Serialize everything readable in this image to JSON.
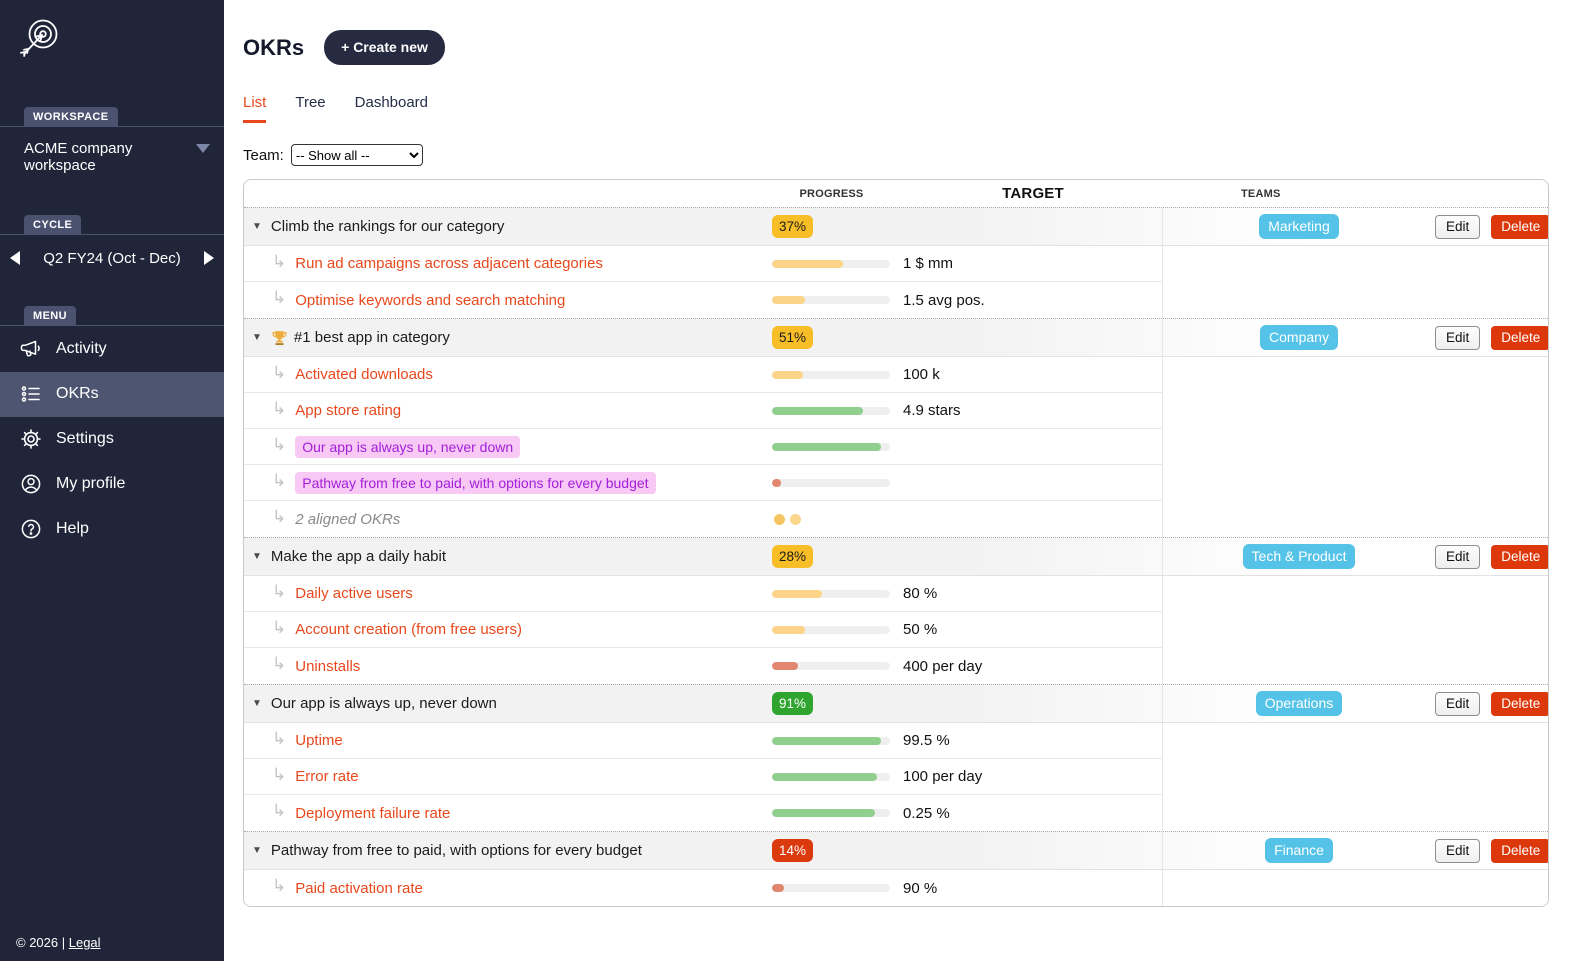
{
  "sidebar": {
    "workspace_label": "WORKSPACE",
    "workspace_name": "ACME company workspace",
    "cycle_label": "CYCLE",
    "cycle_name": "Q2 FY24 (Oct - Dec)",
    "menu_label": "MENU",
    "menu_items": [
      {
        "label": "Activity",
        "icon": "megaphone",
        "active": false
      },
      {
        "label": "OKRs",
        "icon": "okr-list",
        "active": true
      },
      {
        "label": "Settings",
        "icon": "gear",
        "active": false
      },
      {
        "label": "My profile",
        "icon": "profile",
        "active": false
      },
      {
        "label": "Help",
        "icon": "help",
        "active": false
      }
    ],
    "footer_copyright": "© 2026 |",
    "footer_link": "Legal"
  },
  "header": {
    "title": "OKRs",
    "create_button_label": "+ Create new"
  },
  "tabs": [
    {
      "label": "List",
      "active": true
    },
    {
      "label": "Tree",
      "active": false
    },
    {
      "label": "Dashboard",
      "active": false
    }
  ],
  "team_filter": {
    "label": "Team:",
    "selected": "-- Show all --"
  },
  "table": {
    "columns": {
      "progress": "PROGRESS",
      "target": "TARGET",
      "teams": "TEAMS"
    },
    "actions": {
      "edit": "Edit",
      "delete": "Delete"
    },
    "groups": [
      {
        "objective": {
          "title": "Climb the rankings for our category",
          "trophy": false,
          "progress": "37%",
          "progress_level": "amber",
          "team": "Marketing"
        },
        "key_results": [
          {
            "type": "kr",
            "title": "Run ad campaigns across adjacent categories",
            "bar_color": "amber",
            "bar_pct": 60,
            "target": "1 $ mm"
          },
          {
            "type": "kr",
            "title": "Optimise keywords and search matching",
            "bar_color": "amber",
            "bar_pct": 28,
            "target": "1.5 avg pos."
          }
        ]
      },
      {
        "objective": {
          "title": "#1 best app in category",
          "trophy": true,
          "progress": "51%",
          "progress_level": "amber",
          "team": "Company"
        },
        "key_results": [
          {
            "type": "kr",
            "title": "Activated downloads",
            "bar_color": "amber",
            "bar_pct": 26,
            "target": "100 k"
          },
          {
            "type": "kr",
            "title": "App store rating",
            "bar_color": "green",
            "bar_pct": 77,
            "target": "4.9 stars"
          },
          {
            "type": "aligned",
            "title": "Our app is always up, never down",
            "bar_color": "green",
            "bar_pct": 92,
            "target": ""
          },
          {
            "type": "aligned",
            "title": "Pathway from free to paid, with options for every budget",
            "bar_color": "red",
            "bar_pct": 8,
            "target": ""
          },
          {
            "type": "summary",
            "title": "2 aligned OKRs",
            "dots": [
              "#f5c562",
              "#fad88b"
            ],
            "target": ""
          }
        ]
      },
      {
        "objective": {
          "title": "Make the app a daily habit",
          "trophy": false,
          "progress": "28%",
          "progress_level": "amber",
          "team": "Tech & Product"
        },
        "key_results": [
          {
            "type": "kr",
            "title": "Daily active users",
            "bar_color": "amber",
            "bar_pct": 42,
            "target": "80 %"
          },
          {
            "type": "kr",
            "title": "Account creation (from free users)",
            "bar_color": "amber",
            "bar_pct": 28,
            "target": "50 %"
          },
          {
            "type": "kr",
            "title": "Uninstalls",
            "bar_color": "red",
            "bar_pct": 22,
            "target": "400 per day"
          }
        ]
      },
      {
        "objective": {
          "title": "Our app is always up, never down",
          "trophy": false,
          "progress": "91%",
          "progress_level": "green",
          "team": "Operations"
        },
        "key_results": [
          {
            "type": "kr",
            "title": "Uptime",
            "bar_color": "green",
            "bar_pct": 92,
            "target": "99.5 %"
          },
          {
            "type": "kr",
            "title": "Error rate",
            "bar_color": "green",
            "bar_pct": 89,
            "target": "100 per day"
          },
          {
            "type": "kr",
            "title": "Deployment failure rate",
            "bar_color": "green",
            "bar_pct": 87,
            "target": "0.25 %"
          }
        ]
      },
      {
        "objective": {
          "title": "Pathway from free to paid, with options for every budget",
          "trophy": false,
          "progress": "14%",
          "progress_level": "red",
          "team": "Finance"
        },
        "key_results": [
          {
            "type": "kr",
            "title": "Paid activation rate",
            "bar_color": "red",
            "bar_pct": 10,
            "target": "90 %"
          }
        ]
      }
    ]
  },
  "colors": {
    "accent": "#e8481c",
    "sidebar_bg": "#212539",
    "badge_amber": "#f7be27",
    "badge_green": "#2fa52f",
    "badge_red": "#db390e",
    "bar_amber": "#fbd489",
    "bar_green": "#90cf8e",
    "bar_red": "#e2876f",
    "team_badge": "#55c3e8",
    "aligned_bg": "#f8c9f5",
    "aligned_text": "#a21fdb"
  }
}
